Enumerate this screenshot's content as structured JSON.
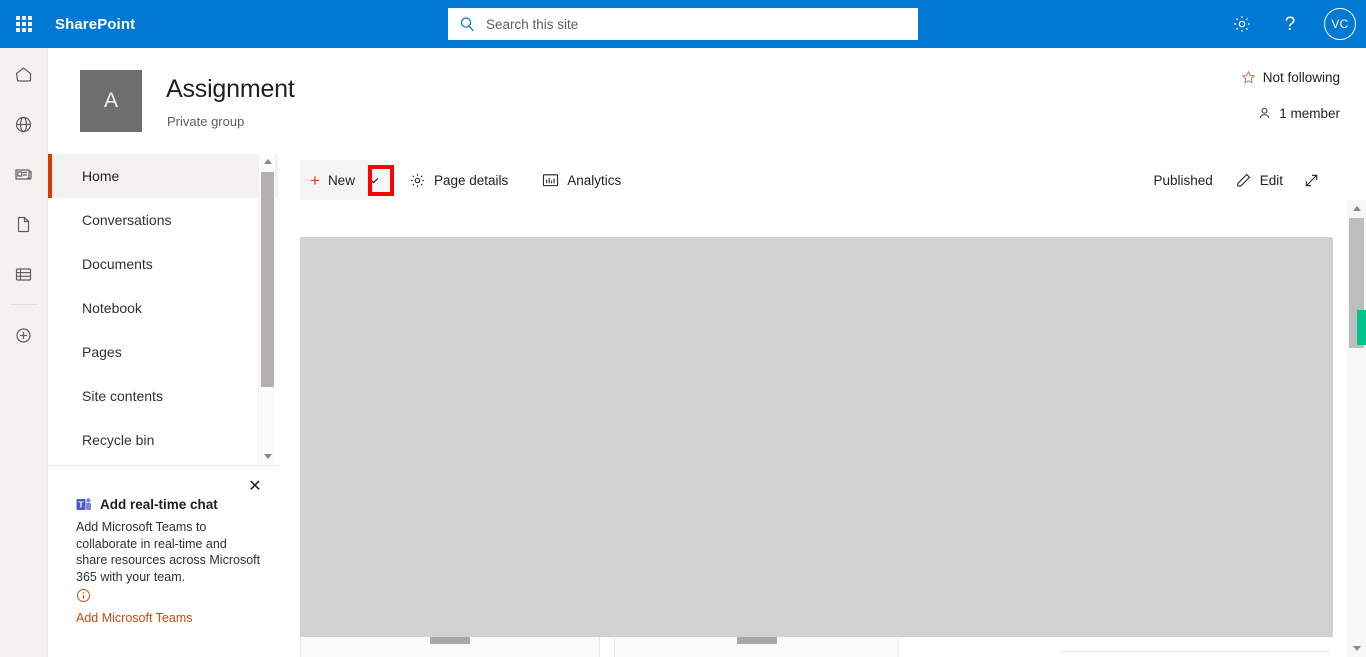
{
  "suite": {
    "waffle_label": "App launcher",
    "brand": "SharePoint",
    "search": {
      "placeholder": "Search this site",
      "value": ""
    },
    "settings_label": "Settings",
    "help_label": "?",
    "avatar_initials": "VC"
  },
  "rail": {
    "items": [
      {
        "name": "home",
        "icon": "home-icon"
      },
      {
        "name": "globe",
        "icon": "globe-icon"
      },
      {
        "name": "news",
        "icon": "news-icon"
      },
      {
        "name": "files",
        "icon": "document-icon"
      },
      {
        "name": "lists",
        "icon": "lists-icon"
      },
      {
        "name": "create",
        "icon": "plus-circle-icon"
      }
    ]
  },
  "site": {
    "logo_letter": "A",
    "title": "Assignment",
    "subtitle": "Private group",
    "follow_label": "Not following",
    "members_label": "1 member"
  },
  "nav": {
    "items": [
      {
        "label": "Home",
        "selected": true
      },
      {
        "label": "Conversations",
        "selected": false
      },
      {
        "label": "Documents",
        "selected": false
      },
      {
        "label": "Notebook",
        "selected": false
      },
      {
        "label": "Pages",
        "selected": false
      },
      {
        "label": "Site contents",
        "selected": false
      },
      {
        "label": "Recycle bin",
        "selected": false
      }
    ]
  },
  "promo": {
    "title": "Add real-time chat",
    "body": "Add Microsoft Teams to collaborate in real-time and share resources across Microsoft 365 with your team.",
    "link": "Add Microsoft Teams",
    "close_label": "✕",
    "info_label": "Information"
  },
  "command_bar": {
    "new_label": "New",
    "new_plus": "+",
    "page_details_label": "Page details",
    "analytics_label": "Analytics",
    "status_label": "Published",
    "edit_label": "Edit",
    "expand_label": "Full screen"
  },
  "annotation": {
    "target": "new-dropdown-chevron",
    "color": "#ff0000"
  },
  "colors": {
    "brand_blue": "#0078d4",
    "accent_orange": "#d83b01",
    "canvas_gray": "#d2d2d2",
    "scroll_marker_green": "#00c389"
  }
}
